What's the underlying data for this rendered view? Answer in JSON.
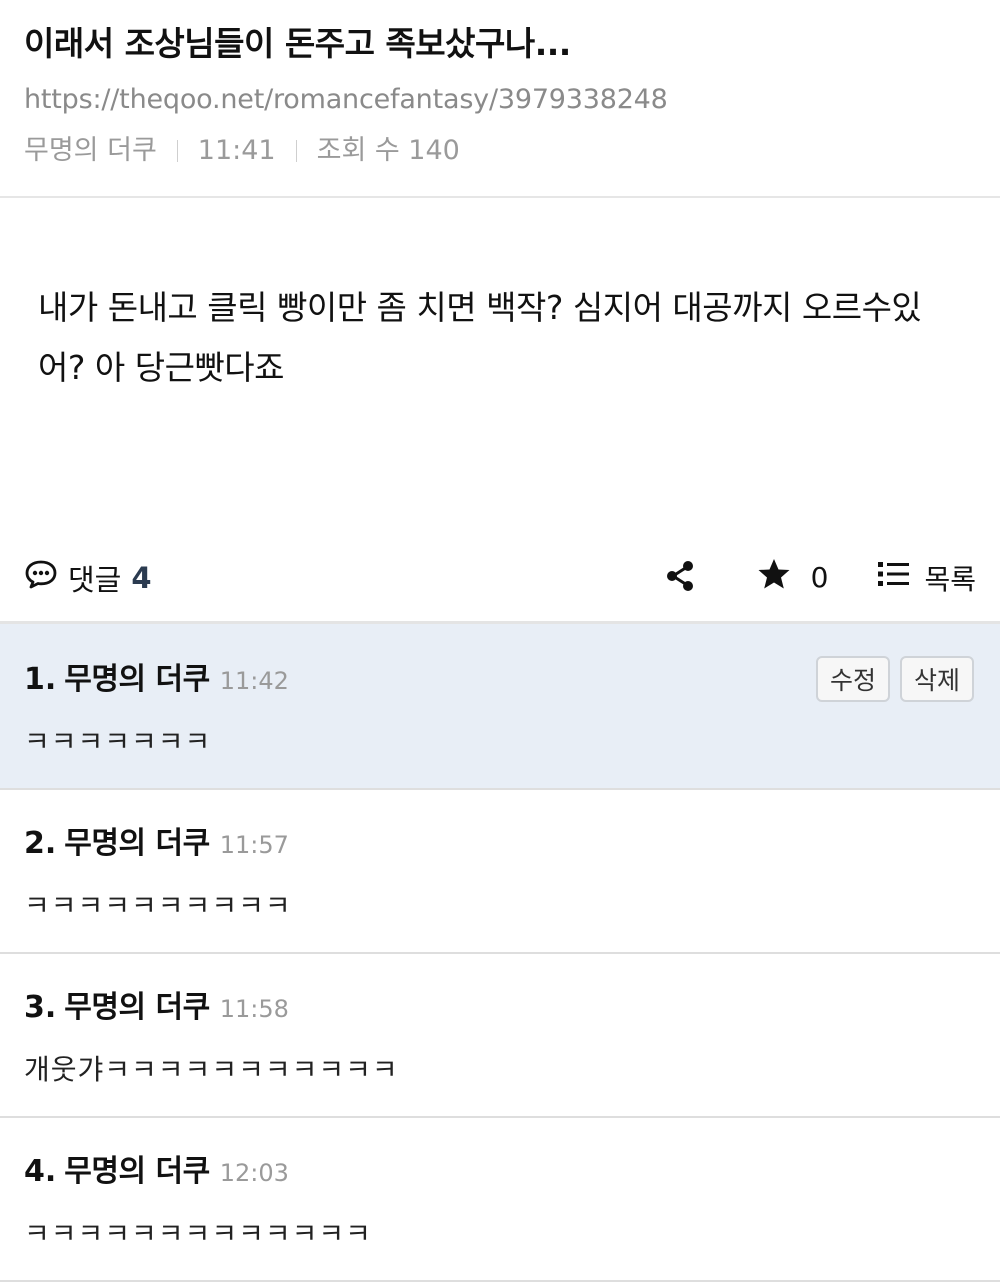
{
  "post": {
    "title": "이래서 조상님들이 돈주고 족보샀구나...",
    "url": "https://theqoo.net/romancefantasy/3979338248",
    "author": "무명의 더쿠",
    "time": "11:41",
    "views_label": "조회 수 140",
    "content": "내가 돈내고 클릭 빵이만 좀 치면 백작? 심지어 대공까지 오르수있어? 아 당근빳다죠"
  },
  "actions": {
    "comment_label": "댓글",
    "comment_count": "4",
    "star_count": "0",
    "list_label": "목록"
  },
  "comments": [
    {
      "num": "1.",
      "author": "무명의 더쿠",
      "time": "11:42",
      "text": "ㅋㅋㅋㅋㅋㅋㅋ",
      "edit_label": "수정",
      "delete_label": "삭제"
    },
    {
      "num": "2.",
      "author": "무명의 더쿠",
      "time": "11:57",
      "text": "ㅋㅋㅋㅋㅋㅋㅋㅋㅋㅋ"
    },
    {
      "num": "3.",
      "author": "무명의 더쿠",
      "time": "11:58",
      "text": "개웃갸ㅋㅋㅋㅋㅋㅋㅋㅋㅋㅋㅋ"
    },
    {
      "num": "4.",
      "author": "무명의 더쿠",
      "time": "12:03",
      "text": "ㅋㅋㅋㅋㅋㅋㅋㅋㅋㅋㅋㅋㅋ"
    }
  ],
  "colors": {
    "highlight_bg": "#e8eef6",
    "count_accent": "#2b3b50",
    "meta_gray": "#9a9a9a"
  },
  "icons": {
    "comment": "speech-bubble-icon",
    "share": "share-icon",
    "star": "star-icon",
    "list": "list-icon"
  }
}
